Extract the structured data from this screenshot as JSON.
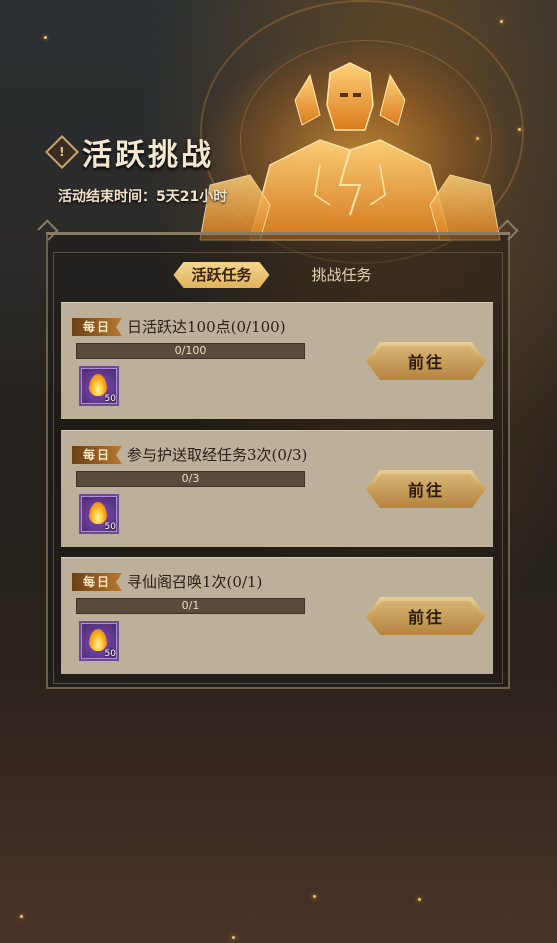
{
  "header": {
    "title": "活跃挑战",
    "title_icon": "exclamation-diamond-icon",
    "end_time_label": "活动结束时间：5天21小时"
  },
  "tabs": [
    {
      "label": "活跃任务",
      "active": true
    },
    {
      "label": "挑战任务",
      "active": false
    }
  ],
  "tasks": [
    {
      "badge": "每日",
      "name": "日活跃达100点(0/100)",
      "progress_text": "0/100",
      "progress": 0,
      "reward_icon": "flame-icon",
      "reward_count": "50",
      "button": "前往"
    },
    {
      "badge": "每日",
      "name": "参与护送取经任务3次(0/3)",
      "progress_text": "0/3",
      "progress": 0,
      "reward_icon": "flame-icon",
      "reward_count": "50",
      "button": "前往"
    },
    {
      "badge": "每日",
      "name": "寻仙阁召唤1次(0/1)",
      "progress_text": "0/1",
      "progress": 0,
      "reward_icon": "flame-icon",
      "reward_count": "50",
      "button": "前往"
    }
  ],
  "colors": {
    "accent_gold": "#e0b35c",
    "card_bg": "#bcb09a",
    "reward_purple": "#5e3587"
  }
}
